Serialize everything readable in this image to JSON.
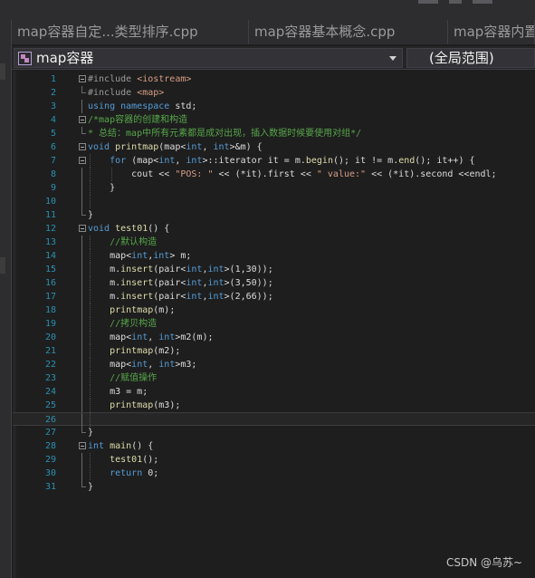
{
  "tabs": [
    {
      "label": "map容器自定...类型排序.cpp"
    },
    {
      "label": "map容器基本概念.cpp"
    },
    {
      "label": "map容器内置"
    }
  ],
  "navbar": {
    "scope_label": "map容器",
    "member_label": "(全局范围)"
  },
  "colors": {
    "keyword": "#569cd6",
    "preprocessor": "#9b9b9b",
    "string": "#d69d85",
    "comment": "#57a64a",
    "function": "#dcdcaa",
    "default": "#dcdcdc",
    "line_number": "#2b91af"
  },
  "code_lines": [
    {
      "n": "1",
      "parts": [
        [
          "pp",
          "#include "
        ],
        [
          "str",
          "<iostream>"
        ]
      ]
    },
    {
      "n": "2",
      "parts": [
        [
          "pp",
          "#include "
        ],
        [
          "str",
          "<map>"
        ]
      ]
    },
    {
      "n": "3",
      "parts": [
        [
          "kw",
          "using namespace "
        ],
        [
          "def",
          "std;"
        ]
      ]
    },
    {
      "n": "4",
      "parts": [
        [
          "cm",
          "/*map容器的创建和构造"
        ]
      ]
    },
    {
      "n": "5",
      "parts": [
        [
          "cm",
          "* 总结：map中所有元素都是成对出现，插入数据时候要使用对组*/"
        ]
      ]
    },
    {
      "n": "6",
      "parts": [
        [
          "kw",
          "void "
        ],
        [
          "fn",
          "printmap"
        ],
        [
          "def",
          "(map<"
        ],
        [
          "kw",
          "int"
        ],
        [
          "def",
          ", "
        ],
        [
          "kw",
          "int"
        ],
        [
          "def",
          ">&m) {"
        ]
      ]
    },
    {
      "n": "7",
      "parts": [
        [
          "def",
          "    "
        ],
        [
          "kw",
          "for "
        ],
        [
          "def",
          "(map<"
        ],
        [
          "kw",
          "int"
        ],
        [
          "def",
          ", "
        ],
        [
          "kw",
          "int"
        ],
        [
          "def",
          ">::iterator it = m."
        ],
        [
          "fn",
          "begin"
        ],
        [
          "def",
          "(); it != m."
        ],
        [
          "fn",
          "end"
        ],
        [
          "def",
          "(); it++) {"
        ]
      ]
    },
    {
      "n": "8",
      "parts": [
        [
          "def",
          "        cout << "
        ],
        [
          "str",
          "\"POS: \""
        ],
        [
          "def",
          " << (*it).first << "
        ],
        [
          "str",
          "\" value:\""
        ],
        [
          "def",
          " << (*it).second <<endl;"
        ]
      ]
    },
    {
      "n": "9",
      "parts": [
        [
          "def",
          "    }"
        ]
      ]
    },
    {
      "n": "10",
      "parts": []
    },
    {
      "n": "11",
      "parts": [
        [
          "def",
          "}"
        ]
      ]
    },
    {
      "n": "12",
      "parts": [
        [
          "kw",
          "void "
        ],
        [
          "fn",
          "test01"
        ],
        [
          "def",
          "() {"
        ]
      ]
    },
    {
      "n": "13",
      "parts": [
        [
          "def",
          "    "
        ],
        [
          "cm",
          "//默认构造"
        ]
      ]
    },
    {
      "n": "14",
      "parts": [
        [
          "def",
          "    map<"
        ],
        [
          "kw",
          "int"
        ],
        [
          "def",
          ","
        ],
        [
          "kw",
          "int"
        ],
        [
          "def",
          "> m;"
        ]
      ]
    },
    {
      "n": "15",
      "parts": [
        [
          "def",
          "    m."
        ],
        [
          "fn",
          "insert"
        ],
        [
          "def",
          "(pair<"
        ],
        [
          "kw",
          "int"
        ],
        [
          "def",
          ","
        ],
        [
          "kw",
          "int"
        ],
        [
          "def",
          ">(1,30));"
        ]
      ]
    },
    {
      "n": "16",
      "parts": [
        [
          "def",
          "    m."
        ],
        [
          "fn",
          "insert"
        ],
        [
          "def",
          "(pair<"
        ],
        [
          "kw",
          "int"
        ],
        [
          "def",
          ","
        ],
        [
          "kw",
          "int"
        ],
        [
          "def",
          ">(3,50));"
        ]
      ]
    },
    {
      "n": "17",
      "parts": [
        [
          "def",
          "    m."
        ],
        [
          "fn",
          "insert"
        ],
        [
          "def",
          "(pair<"
        ],
        [
          "kw",
          "int"
        ],
        [
          "def",
          ","
        ],
        [
          "kw",
          "int"
        ],
        [
          "def",
          ">(2,66));"
        ]
      ]
    },
    {
      "n": "18",
      "parts": [
        [
          "def",
          "    "
        ],
        [
          "fn",
          "printmap"
        ],
        [
          "def",
          "(m);"
        ]
      ]
    },
    {
      "n": "19",
      "parts": [
        [
          "def",
          "    "
        ],
        [
          "cm",
          "//拷贝构造"
        ]
      ]
    },
    {
      "n": "20",
      "parts": [
        [
          "def",
          "    map<"
        ],
        [
          "kw",
          "int"
        ],
        [
          "def",
          ", "
        ],
        [
          "kw",
          "int"
        ],
        [
          "def",
          ">m2(m);"
        ]
      ]
    },
    {
      "n": "21",
      "parts": [
        [
          "def",
          "    "
        ],
        [
          "fn",
          "printmap"
        ],
        [
          "def",
          "(m2);"
        ]
      ]
    },
    {
      "n": "22",
      "parts": [
        [
          "def",
          "    map<"
        ],
        [
          "kw",
          "int"
        ],
        [
          "def",
          ", "
        ],
        [
          "kw",
          "int"
        ],
        [
          "def",
          ">m3;"
        ]
      ]
    },
    {
      "n": "23",
      "parts": [
        [
          "def",
          "    "
        ],
        [
          "cm",
          "//赋值操作"
        ]
      ]
    },
    {
      "n": "24",
      "parts": [
        [
          "def",
          "    m3 = m;"
        ]
      ]
    },
    {
      "n": "25",
      "parts": [
        [
          "def",
          "    "
        ],
        [
          "fn",
          "printmap"
        ],
        [
          "def",
          "(m3);"
        ]
      ]
    },
    {
      "n": "26",
      "parts": []
    },
    {
      "n": "27",
      "parts": [
        [
          "def",
          "}"
        ]
      ]
    },
    {
      "n": "28",
      "parts": [
        [
          "kw",
          "int "
        ],
        [
          "fn",
          "main"
        ],
        [
          "def",
          "() {"
        ]
      ]
    },
    {
      "n": "29",
      "parts": [
        [
          "def",
          "    "
        ],
        [
          "fn",
          "test01"
        ],
        [
          "def",
          "();"
        ]
      ]
    },
    {
      "n": "30",
      "parts": [
        [
          "def",
          "    "
        ],
        [
          "kw",
          "return "
        ],
        [
          "def",
          "0;"
        ]
      ]
    },
    {
      "n": "31",
      "parts": [
        [
          "def",
          "}"
        ]
      ]
    }
  ],
  "watermark": "CSDN @乌苏~"
}
